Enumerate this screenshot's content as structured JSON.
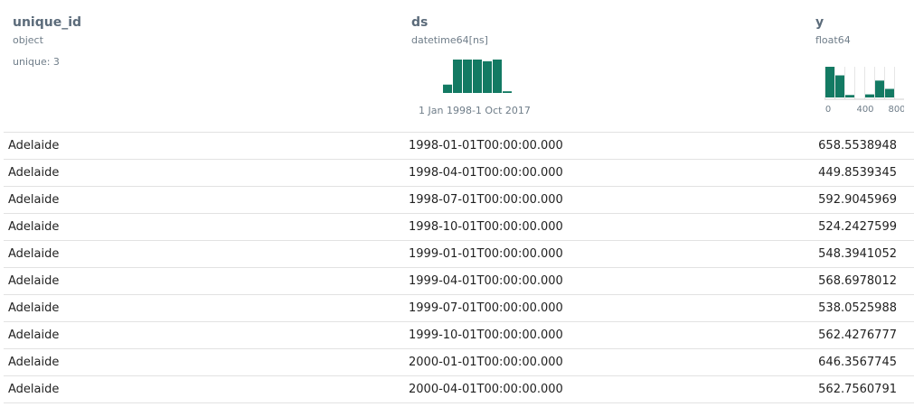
{
  "columns": {
    "unique_id": {
      "name": "unique_id",
      "dtype": "object",
      "unique_label": "unique: 3"
    },
    "ds": {
      "name": "ds",
      "dtype": "datetime64[ns]",
      "range_label": "1 Jan 1998-1 Oct 2017",
      "histogram": [
        0.25,
        1.0,
        1.0,
        1.0,
        0.95,
        1.0,
        0.05
      ],
      "bar_color": "#137a63"
    },
    "y": {
      "name": "y",
      "dtype": "float64",
      "histogram": [
        1.0,
        0.72,
        0.08,
        0.0,
        0.1,
        0.55,
        0.28,
        0.0
      ],
      "bar_color": "#137a63",
      "axis_ticks": [
        "0",
        "400",
        "800"
      ]
    }
  },
  "rows": [
    {
      "unique_id": "Adelaide",
      "ds": "1998-01-01T00:00:00.000",
      "y": "658.5538948"
    },
    {
      "unique_id": "Adelaide",
      "ds": "1998-04-01T00:00:00.000",
      "y": "449.8539345"
    },
    {
      "unique_id": "Adelaide",
      "ds": "1998-07-01T00:00:00.000",
      "y": "592.9045969"
    },
    {
      "unique_id": "Adelaide",
      "ds": "1998-10-01T00:00:00.000",
      "y": "524.2427599"
    },
    {
      "unique_id": "Adelaide",
      "ds": "1999-01-01T00:00:00.000",
      "y": "548.3941052"
    },
    {
      "unique_id": "Adelaide",
      "ds": "1999-04-01T00:00:00.000",
      "y": "568.6978012"
    },
    {
      "unique_id": "Adelaide",
      "ds": "1999-07-01T00:00:00.000",
      "y": "538.0525988"
    },
    {
      "unique_id": "Adelaide",
      "ds": "1999-10-01T00:00:00.000",
      "y": "562.4276777"
    },
    {
      "unique_id": "Adelaide",
      "ds": "2000-01-01T00:00:00.000",
      "y": "646.3567745"
    },
    {
      "unique_id": "Adelaide",
      "ds": "2000-04-01T00:00:00.000",
      "y": "562.7560791"
    }
  ]
}
